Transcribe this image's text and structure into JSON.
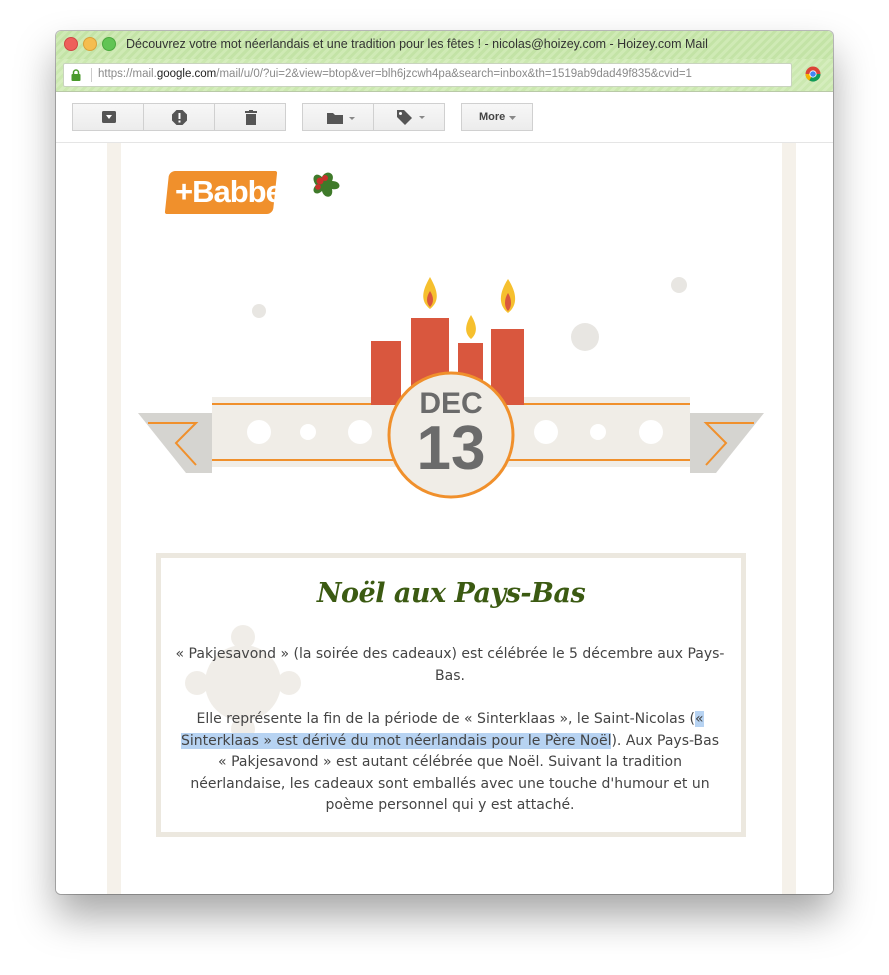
{
  "window": {
    "title": "Découvrez votre mot néerlandais et une tradition pour les fêtes ! - nicolas@hoizey.com - Hoizey.com Mail",
    "url_prefix": "https://mail.",
    "url_domain": "google.com",
    "url_rest": "/mail/u/0/?ui=2&view=btop&ver=blh6jzcwh4pa&search=inbox&th=1519ab9dad49f835&cvid=1"
  },
  "toolbar": {
    "more_label": "More",
    "buttons": [
      "archive-icon",
      "report-spam-icon",
      "delete-icon",
      "move-to-folder-icon",
      "labels-icon"
    ]
  },
  "email": {
    "logo_text": "+Babbel",
    "date_month": "DEC",
    "date_day": "13",
    "card_title": "Noël aux Pays-Bas",
    "para1": "« Pakjesavond » (la soirée des cadeaux) est célébrée le 5 décembre aux Pays-Bas.",
    "para2_before": "Elle représente la fin de la période de « Sinterklaas », le Saint-Nicolas (",
    "para2_highlight": "« Sinterklaas » est dérivé du mot néerlandais pour le Père Noël",
    "para2_after": "). Aux Pays-Bas « Pakjesavond » est autant célébrée que Noël. Suivant la tradition néerlandaise, les cadeaux sont emballés avec une touche d'humour et un poème personnel qui y est attaché."
  },
  "colors": {
    "titlebar": "#cfeab5",
    "brand_orange": "#f0902c",
    "candle_red": "#d9573e",
    "flame_yellow": "#f6c02e",
    "ribbon": "#f0ede7",
    "ribbon_shadow": "#d5d4d0",
    "date_gray": "#6b6b6b",
    "title_green": "#3b5a12",
    "highlight": "#b7d3f2"
  }
}
